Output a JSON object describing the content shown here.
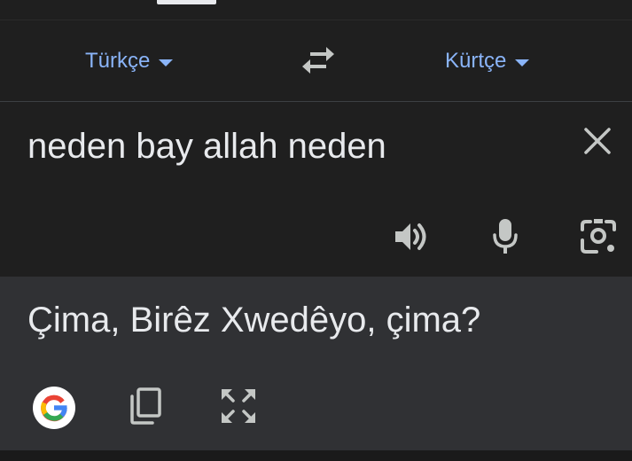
{
  "language_bar": {
    "source_language": "Türkçe",
    "target_language": "Kürtçe",
    "swap_icon": "swap-arrows-icon"
  },
  "source": {
    "text": "neden bay allah neden",
    "icons": [
      "close-icon",
      "speaker-icon",
      "microphone-icon",
      "camera-icon"
    ]
  },
  "translation": {
    "text": "Çima, Birêz Xwedêyo, çima?",
    "icons": [
      "google-logo",
      "copy-icon",
      "fullscreen-icon"
    ]
  },
  "colors": {
    "background": "#1f1f1f",
    "translation_background": "#303134",
    "accent": "#8ab4f8",
    "text": "#e8eaed",
    "icon": "#c4c7c5"
  }
}
